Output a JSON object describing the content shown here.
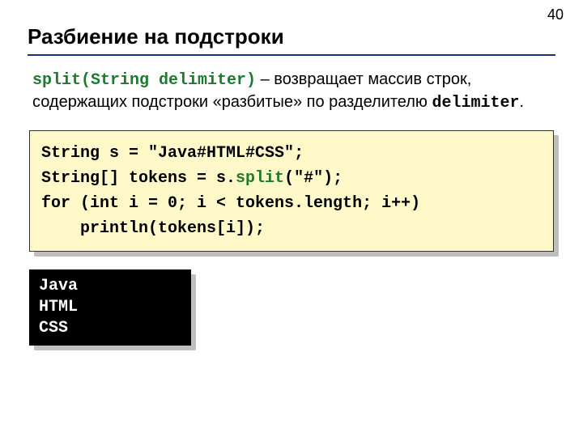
{
  "page_number": "40",
  "title": "Разбиение на подстроки",
  "description": {
    "method_signature": "split(String delimiter)",
    "sep": " – ",
    "text_part1": "возвращает массив строк, содержащих подстроки «разбитые» по разделителю ",
    "delimiter_word": "delimiter",
    "period": "."
  },
  "code": {
    "line1a": "String s = ",
    "line1b": "\"Java#HTML#CSS\"",
    "line1c": ";",
    "line2a": "String[] tokens = s.",
    "line2b": "split",
    "line2c": "(",
    "line2d": "\"#\"",
    "line2e": ");",
    "line3": "for (int i = 0; i < tokens.length; i++)",
    "line4": "    println(tokens[i]);"
  },
  "output": "Java\nHTML\nCSS"
}
